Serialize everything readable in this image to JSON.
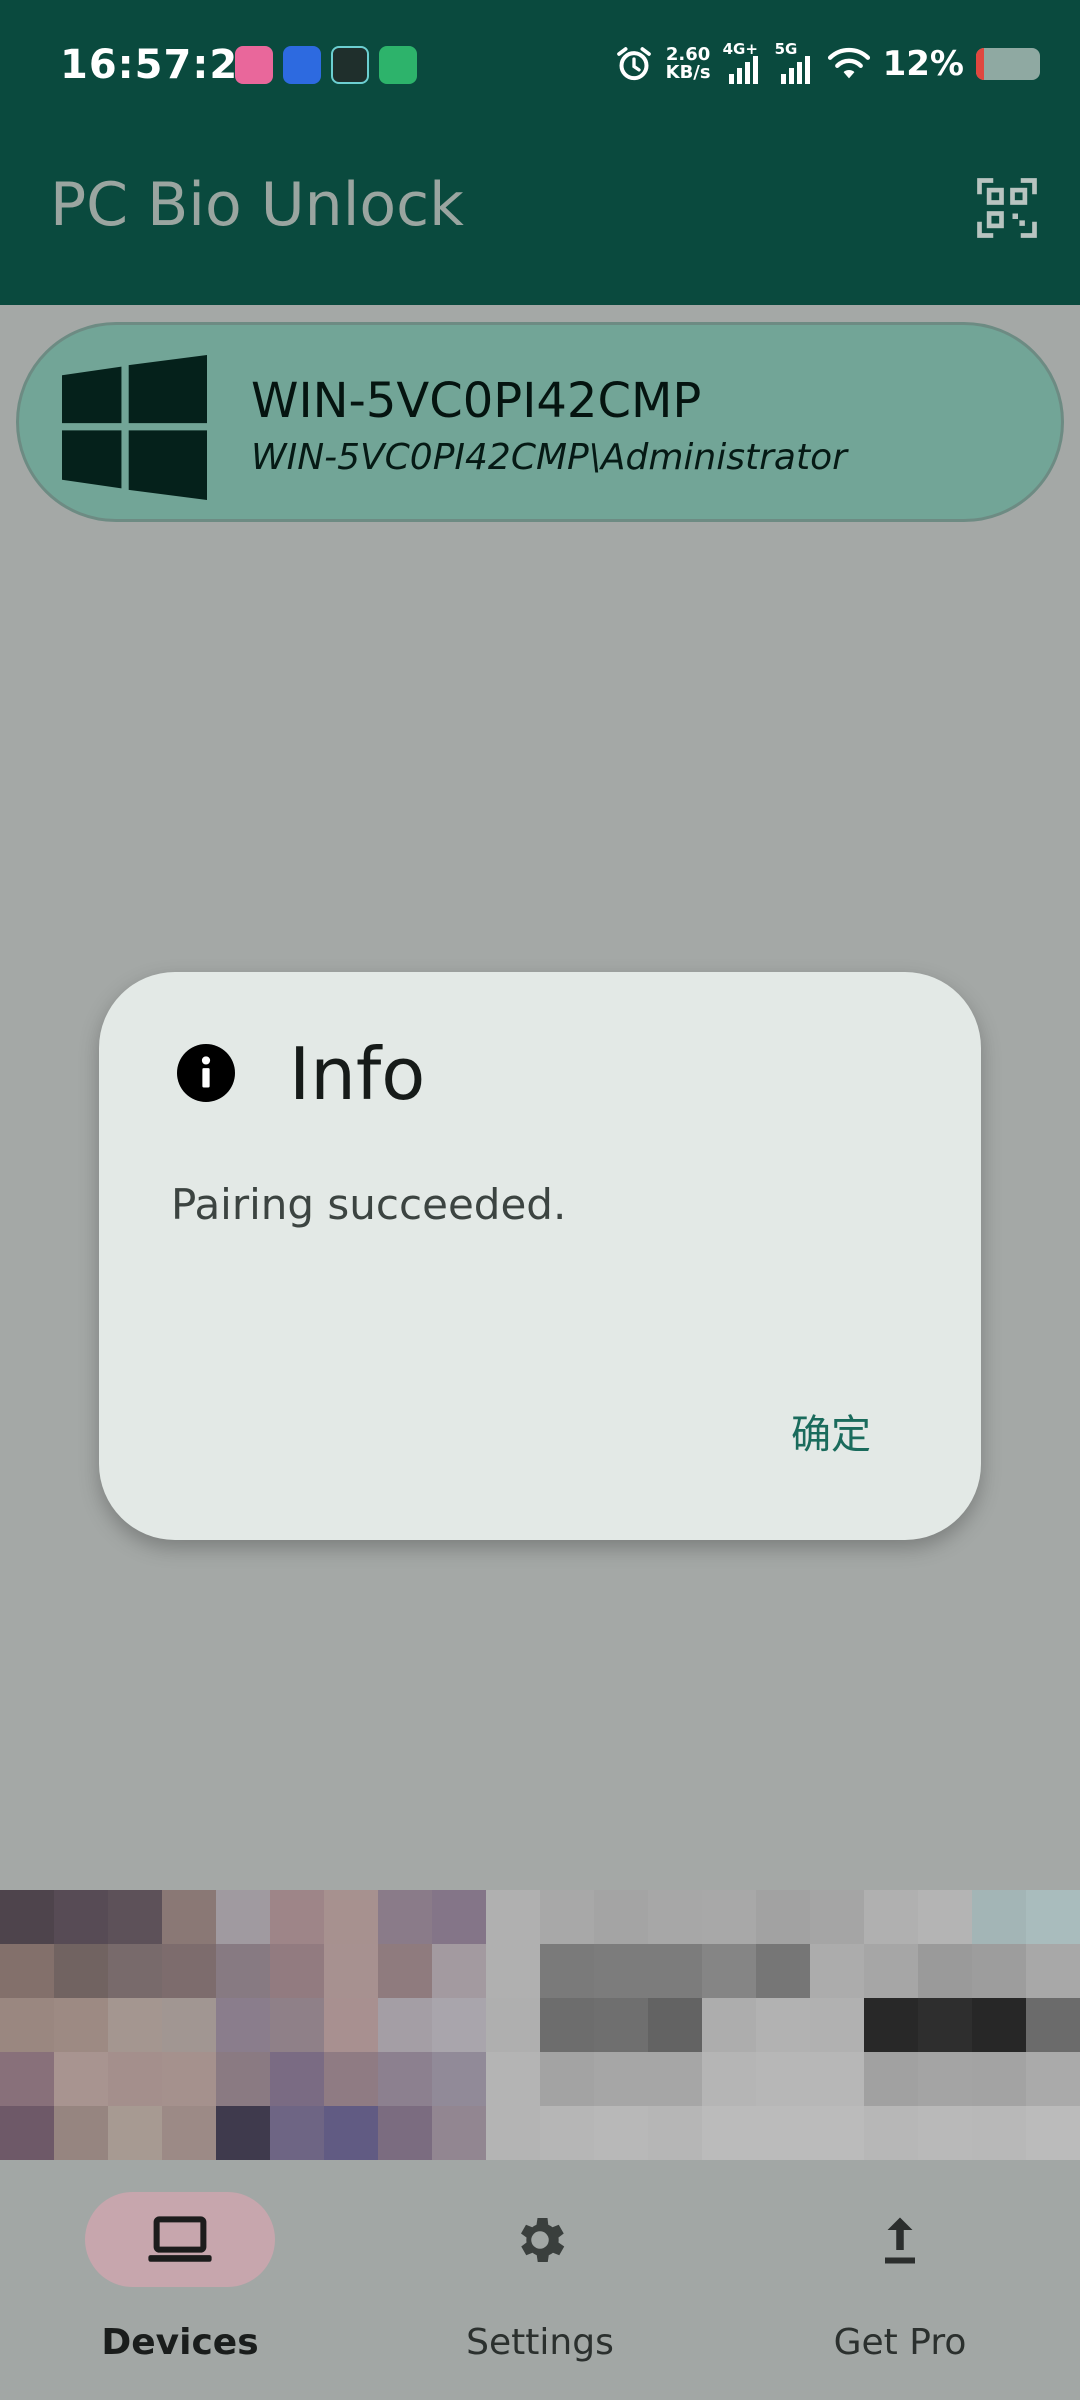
{
  "status_bar": {
    "time": "16:57:29",
    "net_speed_value": "2.60",
    "net_speed_unit": "KB/s",
    "signal_1_tag": "4G+",
    "signal_2_tag": "5G",
    "battery_percent": "12%",
    "battery_level": 0.12,
    "battery_low_color": "#e0473f"
  },
  "app_bar": {
    "title": "PC Bio Unlock",
    "scan_icon": "qr-scan-icon",
    "background_color": "#0a4a3e"
  },
  "devices": [
    {
      "name": "WIN-5VC0PI42CMP",
      "user": "WIN-5VC0PI42CMP\\Administrator",
      "icon": "windows-logo-icon"
    }
  ],
  "dialog": {
    "icon": "info-icon",
    "title": "Info",
    "message": "Pairing succeeded.",
    "ok_label": "确定"
  },
  "bottom_nav": {
    "items": [
      {
        "label": "Devices",
        "icon": "laptop-icon",
        "active": true
      },
      {
        "label": "Settings",
        "icon": "gear-icon",
        "active": false
      },
      {
        "label": "Get Pro",
        "icon": "upload-arrow-icon",
        "active": false
      }
    ],
    "active_color": "#c7a6ad"
  }
}
